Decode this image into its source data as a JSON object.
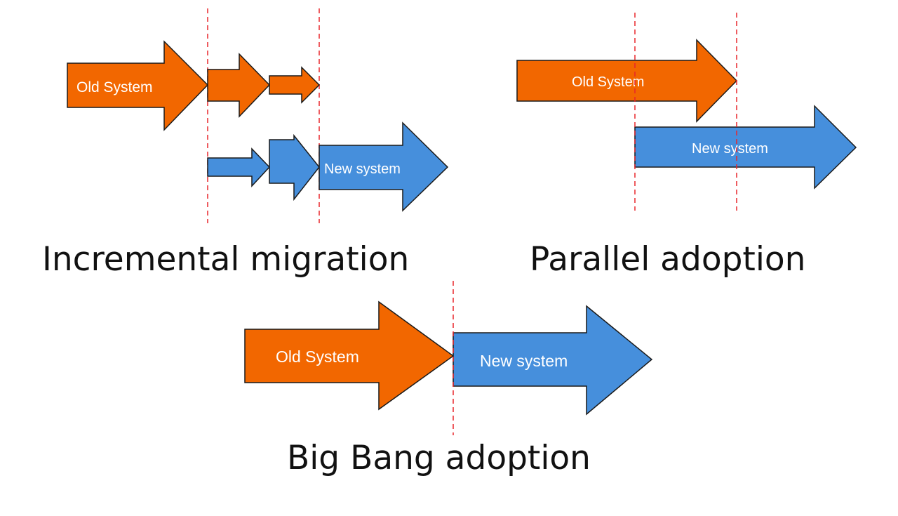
{
  "colors": {
    "old_system": "#f26700",
    "new_system": "#468fdc",
    "divider": "#e8262b",
    "outline": "#1a1a1a"
  },
  "diagrams": {
    "incremental": {
      "caption": "Incremental migration",
      "old_label": "Old System",
      "new_label": "New system",
      "old_steps": 3,
      "new_steps": 3
    },
    "parallel": {
      "caption": "Parallel adoption",
      "old_label": "Old System",
      "new_label": "New system"
    },
    "big_bang": {
      "caption": "Big Bang adoption",
      "old_label": "Old System",
      "new_label": "New system"
    }
  }
}
